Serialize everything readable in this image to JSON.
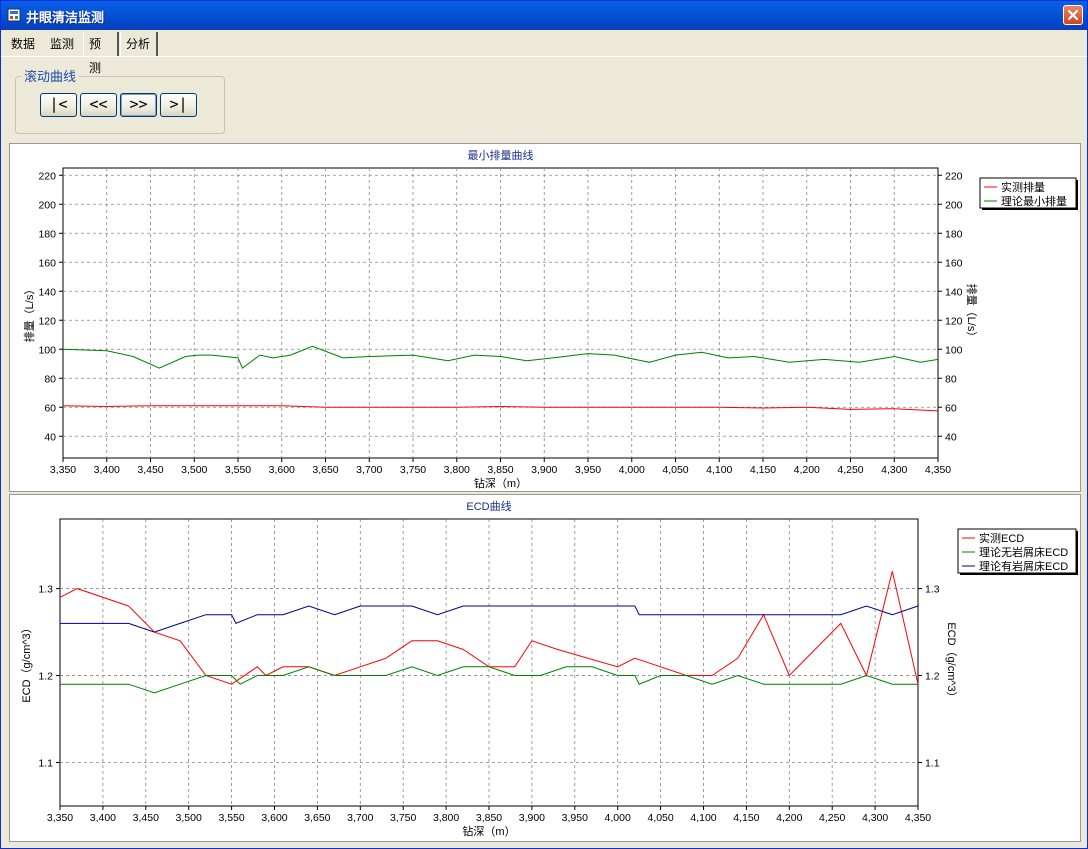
{
  "window": {
    "title": "井眼清洁监测"
  },
  "tabs": [
    {
      "label": "数据"
    },
    {
      "label": "监测"
    },
    {
      "label": "预测"
    },
    {
      "label": "分析"
    }
  ],
  "scroll_group": {
    "label": "滚动曲线",
    "buttons": [
      {
        "label": "|<"
      },
      {
        "label": "<<"
      },
      {
        "label": ">>"
      },
      {
        "label": ">|"
      }
    ]
  },
  "chart_data": [
    {
      "type": "line",
      "title": "最小排量曲线",
      "xlabel": "钻深（m）",
      "ylabel": "排量（L/s）",
      "ylabel_right": "排量（L/s）",
      "xlim": [
        3350,
        4350
      ],
      "ylim": [
        25,
        225
      ],
      "xticks": [
        3350,
        3400,
        3450,
        3500,
        3550,
        3600,
        3650,
        3700,
        3750,
        3800,
        3850,
        3900,
        3950,
        4000,
        4050,
        4100,
        4150,
        4200,
        4250,
        4300,
        4350
      ],
      "xtick_labels": [
        "3,350",
        "3,400",
        "3,450",
        "3,500",
        "3,550",
        "3,600",
        "3,650",
        "3,700",
        "3,750",
        "3,800",
        "3,850",
        "3,900",
        "3,950",
        "4,000",
        "4,050",
        "4,100",
        "4,150",
        "4,200",
        "4,250",
        "4,300",
        "4,350"
      ],
      "yticks": [
        40,
        60,
        80,
        100,
        120,
        140,
        160,
        180,
        200,
        220
      ],
      "ytick_labels": [
        "40",
        "60",
        "80",
        "100",
        "120",
        "140",
        "160",
        "180",
        "200",
        "220"
      ],
      "grid": true,
      "legend_position": "right",
      "series": [
        {
          "name": "实测排量",
          "color": "#ff0000",
          "x": [
            3350,
            3400,
            3450,
            3500,
            3550,
            3600,
            3650,
            3700,
            3750,
            3800,
            3850,
            3900,
            3950,
            4000,
            4050,
            4100,
            4150,
            4200,
            4250,
            4300,
            4350
          ],
          "y": [
            61,
            60.5,
            61,
            61,
            61,
            61,
            60,
            60,
            60,
            60,
            60.5,
            60,
            60,
            60,
            60,
            60,
            59.5,
            60,
            58.5,
            59,
            57.5
          ]
        },
        {
          "name": "理论最小排量",
          "color": "#008000",
          "x": [
            3350,
            3400,
            3430,
            3460,
            3490,
            3505,
            3520,
            3550,
            3555,
            3575,
            3590,
            3610,
            3635,
            3670,
            3700,
            3750,
            3790,
            3820,
            3850,
            3880,
            3910,
            3950,
            3980,
            4020,
            4050,
            4080,
            4110,
            4140,
            4180,
            4220,
            4260,
            4300,
            4330,
            4350
          ],
          "y": [
            100,
            99,
            95,
            87,
            95,
            96,
            96,
            94,
            87,
            96,
            94,
            96,
            102,
            94,
            95,
            96,
            92,
            96,
            95,
            92,
            94,
            97,
            96,
            91,
            96,
            98,
            94,
            95,
            91,
            93,
            91,
            95,
            91,
            93
          ]
        }
      ]
    },
    {
      "type": "line",
      "title": "ECD曲线",
      "xlabel": "钻深（m）",
      "ylabel": "ECD（g/cm^3）",
      "ylabel_right": "ECD（g/cm^3）",
      "xlim": [
        3350,
        4350
      ],
      "ylim": [
        1.05,
        1.38
      ],
      "xticks": [
        3350,
        3400,
        3450,
        3500,
        3550,
        3600,
        3650,
        3700,
        3750,
        3800,
        3850,
        3900,
        3950,
        4000,
        4050,
        4100,
        4150,
        4200,
        4250,
        4300,
        4350
      ],
      "xtick_labels": [
        "3,350",
        "3,400",
        "3,450",
        "3,500",
        "3,550",
        "3,600",
        "3,650",
        "3,700",
        "3,750",
        "3,800",
        "3,850",
        "3,900",
        "3,950",
        "4,000",
        "4,050",
        "4,100",
        "4,150",
        "4,200",
        "4,250",
        "4,300",
        "4,350"
      ],
      "yticks": [
        1.1,
        1.2,
        1.3
      ],
      "ytick_labels": [
        "1.1",
        "1.2",
        "1.3"
      ],
      "grid": true,
      "legend_position": "right",
      "series": [
        {
          "name": "实测ECD",
          "color": "#ff0000",
          "x": [
            3350,
            3370,
            3430,
            3460,
            3490,
            3520,
            3550,
            3580,
            3590,
            3610,
            3640,
            3670,
            3700,
            3730,
            3760,
            3790,
            3820,
            3850,
            3880,
            3900,
            3930,
            4000,
            4020,
            4050,
            4080,
            4110,
            4140,
            4170,
            4200,
            4230,
            4260,
            4290,
            4320,
            4350
          ],
          "y": [
            1.29,
            1.3,
            1.28,
            1.25,
            1.24,
            1.2,
            1.19,
            1.21,
            1.2,
            1.21,
            1.21,
            1.2,
            1.21,
            1.22,
            1.24,
            1.24,
            1.23,
            1.21,
            1.21,
            1.24,
            1.23,
            1.21,
            1.22,
            1.21,
            1.2,
            1.2,
            1.22,
            1.27,
            1.2,
            1.23,
            1.26,
            1.2,
            1.32,
            1.19
          ]
        },
        {
          "name": "理论无岩屑床ECD",
          "color": "#008000",
          "x": [
            3350,
            3380,
            3430,
            3460,
            3490,
            3520,
            3550,
            3560,
            3580,
            3610,
            3640,
            3670,
            3700,
            3730,
            3760,
            3790,
            3820,
            3850,
            3880,
            3910,
            3940,
            3970,
            4000,
            4020,
            4025,
            4050,
            4080,
            4110,
            4140,
            4170,
            4200,
            4230,
            4260,
            4290,
            4320,
            4350
          ],
          "y": [
            1.19,
            1.19,
            1.19,
            1.18,
            1.19,
            1.2,
            1.2,
            1.19,
            1.2,
            1.2,
            1.21,
            1.2,
            1.2,
            1.2,
            1.21,
            1.2,
            1.21,
            1.21,
            1.2,
            1.2,
            1.21,
            1.21,
            1.2,
            1.2,
            1.19,
            1.2,
            1.2,
            1.19,
            1.2,
            1.19,
            1.19,
            1.19,
            1.19,
            1.2,
            1.19,
            1.19
          ]
        },
        {
          "name": "理论有岩屑床ECD",
          "color": "#00008b",
          "x": [
            3350,
            3380,
            3430,
            3460,
            3490,
            3520,
            3550,
            3555,
            3580,
            3610,
            3640,
            3670,
            3700,
            3730,
            3760,
            3790,
            3820,
            3850,
            3880,
            3910,
            3940,
            3970,
            4000,
            4020,
            4025,
            4050,
            4080,
            4110,
            4140,
            4170,
            4200,
            4230,
            4260,
            4290,
            4320,
            4350
          ],
          "y": [
            1.26,
            1.26,
            1.26,
            1.25,
            1.26,
            1.27,
            1.27,
            1.26,
            1.27,
            1.27,
            1.28,
            1.27,
            1.28,
            1.28,
            1.28,
            1.27,
            1.28,
            1.28,
            1.28,
            1.28,
            1.28,
            1.28,
            1.28,
            1.28,
            1.27,
            1.27,
            1.27,
            1.27,
            1.27,
            1.27,
            1.27,
            1.27,
            1.27,
            1.28,
            1.27,
            1.28
          ]
        }
      ]
    }
  ]
}
